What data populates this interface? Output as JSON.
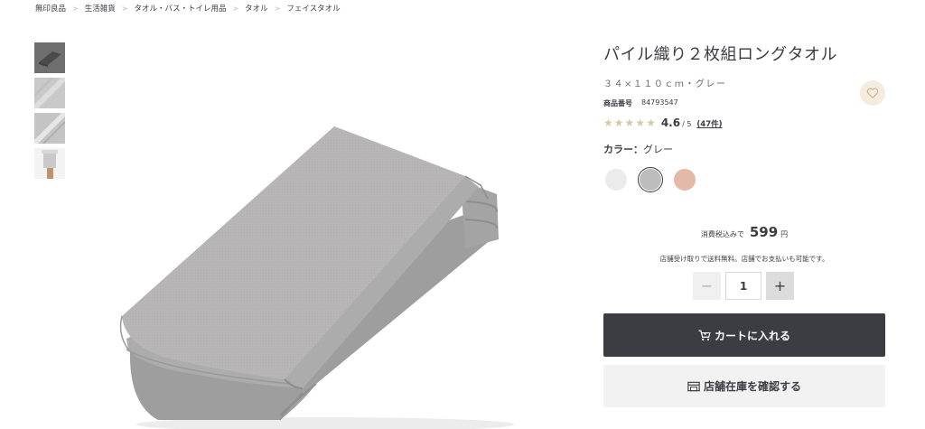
{
  "breadcrumb": [
    "無印良品",
    "生活雑貨",
    "タオル・バス・トイレ用品",
    "タオル",
    "フェイスタオル"
  ],
  "breadcrumb_separator": ">",
  "product": {
    "title": "パイル織り２枚組ロングタオル",
    "subtitle": "３４×１１０ｃｍ・グレー",
    "code_label": "商品番号",
    "code": "84793547",
    "rating": {
      "value": 4.6,
      "value_text": "4.6",
      "out_of": "/ 5",
      "reviews": "(47件)",
      "stars": [
        "★",
        "★",
        "★",
        "★",
        "★"
      ]
    },
    "color_label": "カラー：",
    "color_value": "グレー",
    "swatches": [
      {
        "name": "white",
        "color": "#ebebeb",
        "selected": false
      },
      {
        "name": "gray",
        "color": "#bdbdbd",
        "selected": true
      },
      {
        "name": "pink",
        "color": "#e3b9a8",
        "selected": false
      }
    ]
  },
  "price": {
    "prefix": "消費税込みで",
    "amount": "599",
    "unit": "円"
  },
  "shipping_note": "店舗受け取りで送料無料。店舗でお支払いも可能です。",
  "quantity": {
    "minus": "−",
    "value": "1",
    "plus": "+"
  },
  "buttons": {
    "cart": "カートに入れる",
    "stock": "店舗在庫を確認する"
  },
  "colors": {
    "dark": "#3c3c43",
    "star": "#d6c9a6",
    "fav_bg": "#f4ecdf",
    "towel": "#b4b3b3"
  },
  "icons": {
    "cart": "cart-icon",
    "store": "store-icon",
    "favorite": "heart-icon"
  }
}
